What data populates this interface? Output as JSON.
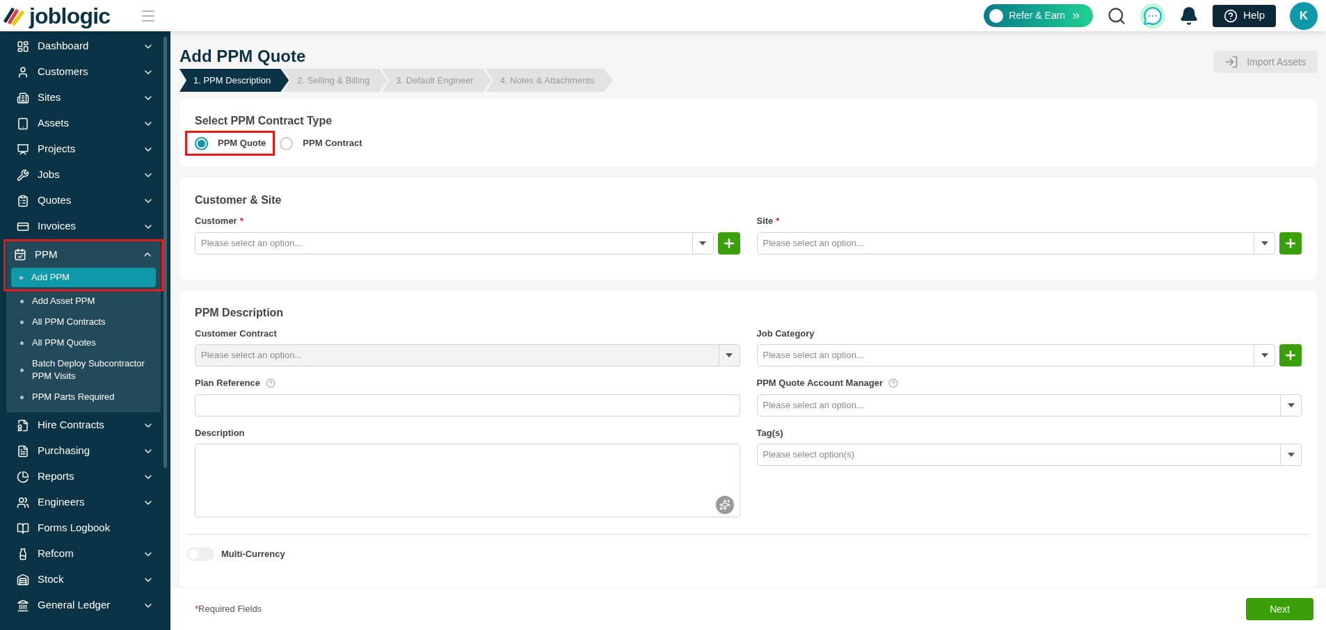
{
  "header": {
    "logo": "joblogic",
    "refer_button": "Refer & Earn",
    "help_button": "Help",
    "avatar": "K"
  },
  "sidebar": {
    "items": [
      {
        "label": "Dashboard",
        "expanded": false
      },
      {
        "label": "Customers",
        "expanded": false
      },
      {
        "label": "Sites",
        "expanded": false
      },
      {
        "label": "Assets",
        "expanded": false
      },
      {
        "label": "Projects",
        "expanded": false
      },
      {
        "label": "Jobs",
        "expanded": false
      },
      {
        "label": "Quotes",
        "expanded": false
      },
      {
        "label": "Invoices",
        "expanded": false
      },
      {
        "label": "PPM",
        "expanded": true,
        "highlighted": true,
        "children": [
          {
            "label": "Add PPM",
            "selected": true
          },
          {
            "label": "Add Asset PPM",
            "selected": false
          },
          {
            "label": "All PPM Contracts",
            "selected": false
          },
          {
            "label": "All PPM Quotes",
            "selected": false
          },
          {
            "label": "Batch Deploy Subcontractor PPM Visits",
            "selected": false
          },
          {
            "label": "PPM Parts Required",
            "selected": false
          }
        ]
      },
      {
        "label": "Hire Contracts",
        "expanded": false
      },
      {
        "label": "Purchasing",
        "expanded": false
      },
      {
        "label": "Reports",
        "expanded": false
      },
      {
        "label": "Engineers",
        "expanded": false
      },
      {
        "label": "Forms Logbook"
      },
      {
        "label": "Refcom",
        "expanded": false
      },
      {
        "label": "Stock",
        "expanded": false
      },
      {
        "label": "General Ledger",
        "expanded": false
      }
    ]
  },
  "page": {
    "title": "Add PPM Quote",
    "import_button": {
      "label": "Import Assets",
      "disabled": true
    }
  },
  "steps": [
    {
      "label": "1. PPM Description",
      "selected": true
    },
    {
      "label": "2. Selling & Billing",
      "selected": false
    },
    {
      "label": "3. Default Engineer",
      "selected": false
    },
    {
      "label": "4. Notes & Attachments",
      "selected": false
    }
  ],
  "contract_type": {
    "title": "Select PPM Contract Type",
    "options": [
      {
        "label": "PPM Quote",
        "selected": true,
        "highlighted": true
      },
      {
        "label": "PPM Contract",
        "selected": false,
        "highlighted": false
      }
    ]
  },
  "customer_site": {
    "title": "Customer & Site",
    "fields": [
      {
        "label": "Customer",
        "required": true,
        "placeholder": "Please select an option...",
        "add": true
      },
      {
        "label": "Site",
        "required": true,
        "placeholder": "Please select an option...",
        "add": true
      }
    ]
  },
  "ppm_description": {
    "title": "PPM Description",
    "fields": [
      {
        "kind": "select",
        "label": "Customer Contract",
        "placeholder": "Please select an option...",
        "disabled": true,
        "add": false
      },
      {
        "kind": "select",
        "label": "Job Category",
        "placeholder": "Please select an option...",
        "disabled": false,
        "add": true
      },
      {
        "kind": "text",
        "label": "Plan Reference",
        "help": true
      },
      {
        "kind": "select",
        "label": "PPM Quote Account Manager",
        "placeholder": "Please select an option...",
        "disabled": false,
        "add": false,
        "help": true
      },
      {
        "kind": "textarea",
        "label": "Description"
      },
      {
        "kind": "select",
        "label": "Tag(s)",
        "placeholder": "Please select option(s)",
        "disabled": false,
        "add": false
      }
    ],
    "multi_currency": {
      "label": "Multi-Currency",
      "on": false
    }
  },
  "footer": {
    "required_mark": "*",
    "required_note": "Required Fields",
    "next_button": "Next"
  }
}
